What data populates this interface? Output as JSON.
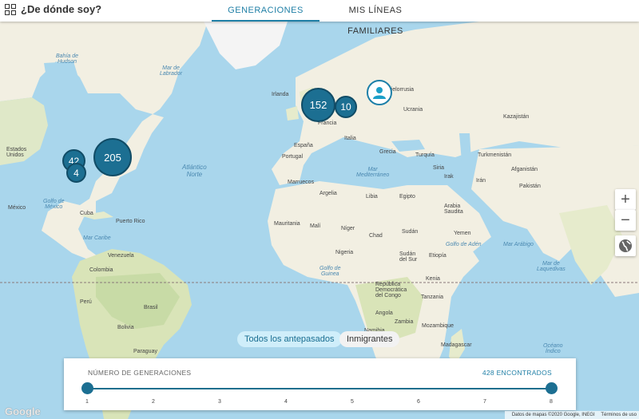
{
  "header": {
    "title": "¿De dónde soy?",
    "tabs": [
      {
        "label": "GENERACIONES",
        "active": true
      },
      {
        "label": "MIS LÍNEAS FAMILIARES",
        "active": false
      }
    ]
  },
  "map": {
    "labels": {
      "bahia_de_hudson": "Bahía de\nHudson",
      "mar_de_labrador": "Mar de\nLabrador",
      "estados_unidos": "Estados\nUnidos",
      "mexico": "México",
      "golfo_de_mexico": "Golfo de\nMéxico",
      "mar_caribe": "Mar Caribe",
      "cuba": "Cuba",
      "puerto_rico": "Puerto Rico",
      "venezuela": "Venezuela",
      "colombia": "Colombia",
      "peru": "Perú",
      "brasil": "Brasil",
      "bolivia": "Bolivia",
      "paraguay": "Paraguay",
      "atlantico_norte": "Atlántico\nNorte",
      "irlanda": "Irlanda",
      "francia": "Francia",
      "espana": "España",
      "portugal": "Portugal",
      "italia": "Italia",
      "grecia": "Grecia",
      "bielorrusia": "Bielorrusia",
      "ucrania": "Ucrania",
      "turquia": "Turquía",
      "siria": "Siria",
      "irak": "Irak",
      "iran": "Irán",
      "kazajistan": "Kazajistán",
      "turkmenistan": "Turkmenistán",
      "afganistan": "Afganistán",
      "pakistan": "Pakistán",
      "marruecos": "Marruecos",
      "argelia": "Argelia",
      "libia": "Libia",
      "egipto": "Egipto",
      "arabia_saudita": "Arabia\nSaudita",
      "mar_mediterraneo": "Mar\nMediterráneo",
      "mauritania": "Mauritania",
      "mali": "Malí",
      "niger": "Níger",
      "chad": "Chad",
      "sudan": "Sudán",
      "sudan_del_sur": "Sudán\ndel Sur",
      "nigeria": "Nigeria",
      "etiopia": "Etiopía",
      "kenia": "Kenia",
      "yemen": "Yemen",
      "golfo_de_aden": "Golfo de Adén",
      "mar_arabigo": "Mar Arábigo",
      "mar_de_laquedivas": "Mar de\nLaquedivas",
      "golfo_de_guinea": "Golfo de\nGuinea",
      "rep_congo": "República\nDemocrática\ndel Congo",
      "tanzania": "Tanzania",
      "angola": "Angola",
      "zambia": "Zambia",
      "mozambique": "Mozambique",
      "madagascar": "Madagascar",
      "namibia": "Namibia",
      "oceano_indico": "Océano\nÍndico"
    },
    "clusters": [
      {
        "label": "152"
      },
      {
        "label": "10"
      },
      {
        "label": "205"
      },
      {
        "label": "42"
      },
      {
        "label": "4"
      }
    ],
    "controls": {
      "zoom_in": "+",
      "zoom_out": "−"
    },
    "attribution": "Datos de mapas ©2020 Google, INEGI",
    "terms": "Términos de uso",
    "google_logo": "Google"
  },
  "filters": {
    "all_ancestors": "Todos los antepasados",
    "immigrants": "Inmigrantes"
  },
  "generations": {
    "label": "NÚMERO DE GENERACIONES",
    "count_text": "428 ENCONTRADOS",
    "ticks": [
      "1",
      "2",
      "3",
      "4",
      "5",
      "6",
      "7",
      "8"
    ],
    "min": 1,
    "max": 8,
    "selected_range": [
      1,
      8
    ]
  },
  "colors": {
    "accent": "#1f7fa6",
    "cluster": "#1c6f92",
    "ocean": "#a9d6ec",
    "land": "#f2efe2"
  }
}
